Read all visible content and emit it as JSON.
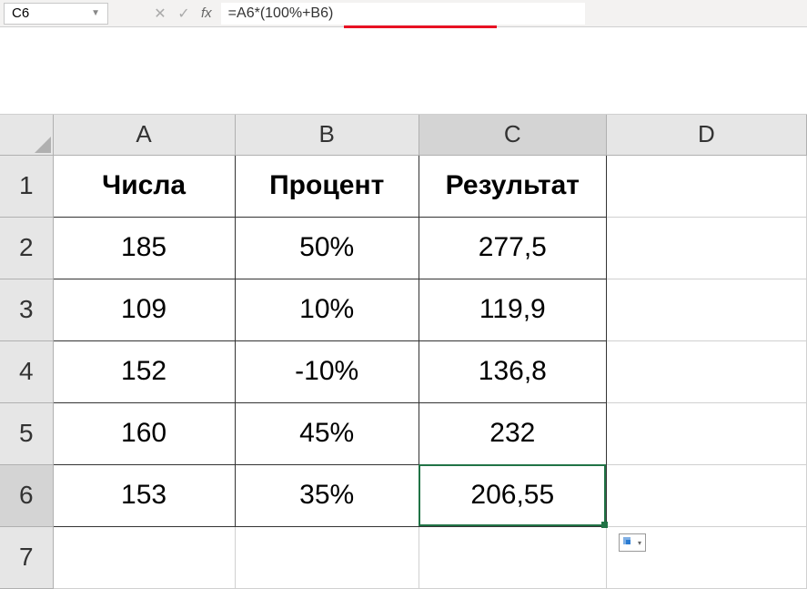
{
  "formulaBar": {
    "nameBox": "C6",
    "formula": "=A6*(100%+B6)",
    "fxLabel": "fx"
  },
  "columns": [
    "A",
    "B",
    "C",
    "D"
  ],
  "headers": {
    "A": "Числа",
    "B": "Процент",
    "C": "Результат"
  },
  "rows": [
    {
      "num": "1",
      "A": "Числа",
      "B": "Процент",
      "C": "Результат",
      "D": "",
      "isHeader": true
    },
    {
      "num": "2",
      "A": "185",
      "B": "50%",
      "C": "277,5",
      "D": ""
    },
    {
      "num": "3",
      "A": "109",
      "B": "10%",
      "C": "119,9",
      "D": ""
    },
    {
      "num": "4",
      "A": "152",
      "B": "-10%",
      "C": "136,8",
      "D": ""
    },
    {
      "num": "5",
      "A": "160",
      "B": "45%",
      "C": "232",
      "D": ""
    },
    {
      "num": "6",
      "A": "153",
      "B": "35%",
      "C": "206,55",
      "D": ""
    },
    {
      "num": "7",
      "A": "",
      "B": "",
      "C": "",
      "D": ""
    }
  ],
  "activeCell": "C6",
  "activeCol": "C",
  "activeRow": "6"
}
